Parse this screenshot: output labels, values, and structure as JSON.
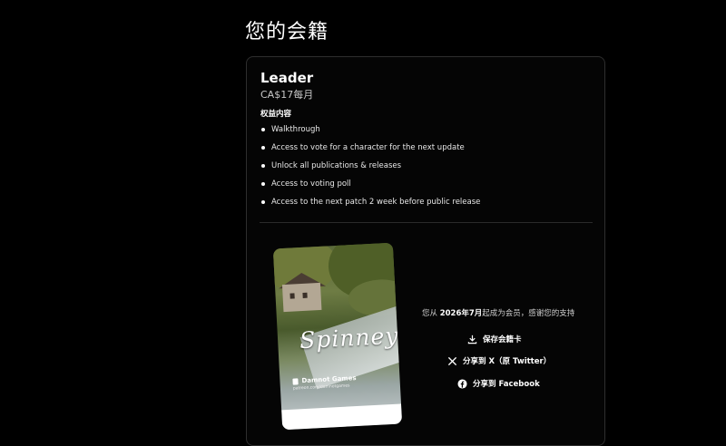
{
  "page": {
    "title": "您的会籍"
  },
  "tier": {
    "name": "Leader",
    "price": "CA$17每月",
    "benefits_heading": "权益内容",
    "benefits": [
      "Walkthrough",
      "Access to vote for a character for the next update",
      "Unlock all publications & releases",
      "Access to voting poll",
      "Access to the next patch 2 week before public release"
    ]
  },
  "membership_card": {
    "art_text": "Spinney",
    "creator_name": "Damnot Games",
    "creator_url": "patreon.com/damnotgames"
  },
  "member_since": {
    "prefix": "您从 ",
    "date": "2026年7月",
    "suffix": "起成为会员，感谢您的支持"
  },
  "actions": {
    "save": "保存会籍卡",
    "share_x": "分享到 X（原 Twitter）",
    "share_facebook": "分享到 Facebook"
  },
  "colors": {
    "background": "#000000",
    "card_border": "#2e2e2e",
    "text": "#ffffff"
  }
}
